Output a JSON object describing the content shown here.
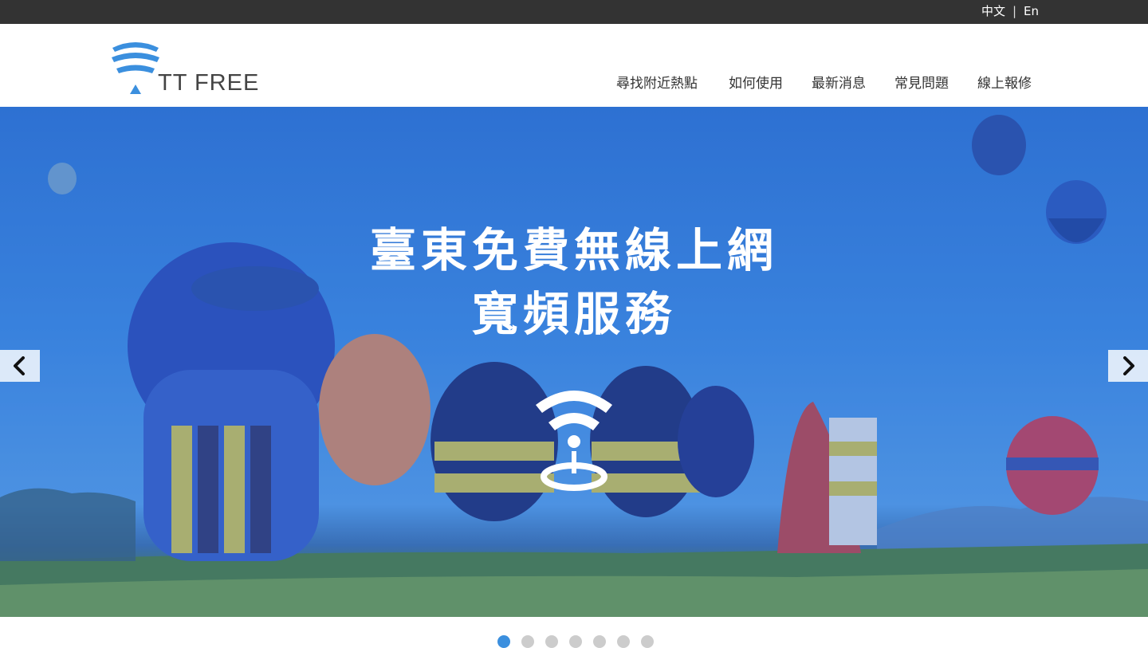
{
  "topbar": {
    "lang_zh": "中文",
    "separator": "|",
    "lang_en": "En"
  },
  "header": {
    "logo_text": "TT FREE",
    "nav": [
      {
        "label": "尋找附近熱點"
      },
      {
        "label": "如何使用"
      },
      {
        "label": "最新消息"
      },
      {
        "label": "常見問題"
      },
      {
        "label": "線上報修"
      }
    ]
  },
  "hero": {
    "title_line1": "臺東免費無線上網",
    "title_line2": "寬頻服務",
    "prev_icon": "chevron-left-icon",
    "next_icon": "chevron-right-icon"
  },
  "slider": {
    "dot_count": 7,
    "active_index": 0
  },
  "colors": {
    "topbar_bg": "#333333",
    "accent": "#3b8fde",
    "logo_blue": "#3b8fde",
    "hero_blue": "#3f8be0"
  }
}
